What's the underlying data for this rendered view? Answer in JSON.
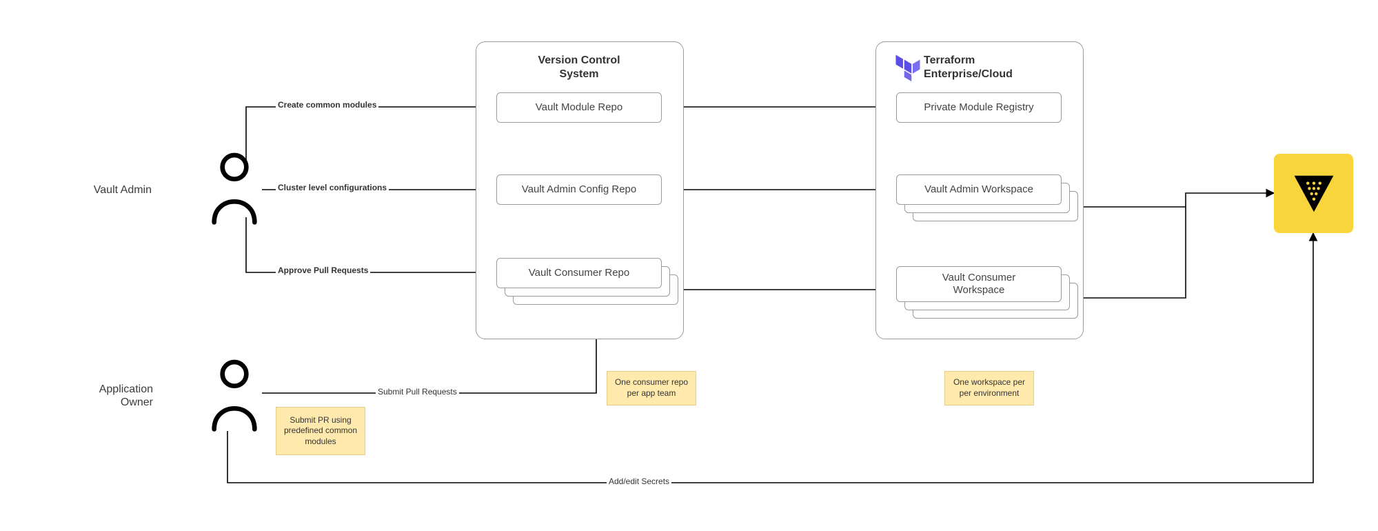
{
  "actors": {
    "vault_admin": {
      "label": "Vault Admin"
    },
    "app_owner": {
      "label": "Application\nOwner"
    }
  },
  "groups": {
    "vcs": {
      "title": "Version Control\nSystem",
      "nodes": {
        "module_repo": "Vault Module Repo",
        "admin_repo": "Vault Admin Config Repo",
        "consumer_repo": "Vault Consumer Repo"
      }
    },
    "tfe": {
      "title": "Terraform\nEnterprise/Cloud",
      "nodes": {
        "pmr": "Private Module Registry",
        "admin_ws": "Vault Admin Workspace",
        "consumer_ws": "Vault Consumer\nWorkspace"
      }
    }
  },
  "edges": {
    "create_modules": "Create common modules",
    "cluster_config": "Cluster level configurations",
    "approve_prs": "Approve Pull Requests",
    "submit_prs": "Submit Pull Requests",
    "add_secrets": "Add/edit Secrets"
  },
  "notes": {
    "submit_pr_note": "Submit PR using predefined common modules",
    "consumer_repo_note": "One consumer repo per app team",
    "workspace_note": "One workspace per per environment"
  },
  "icons": {
    "vault": "vault-icon",
    "terraform": "terraform-icon",
    "person": "person-icon"
  }
}
